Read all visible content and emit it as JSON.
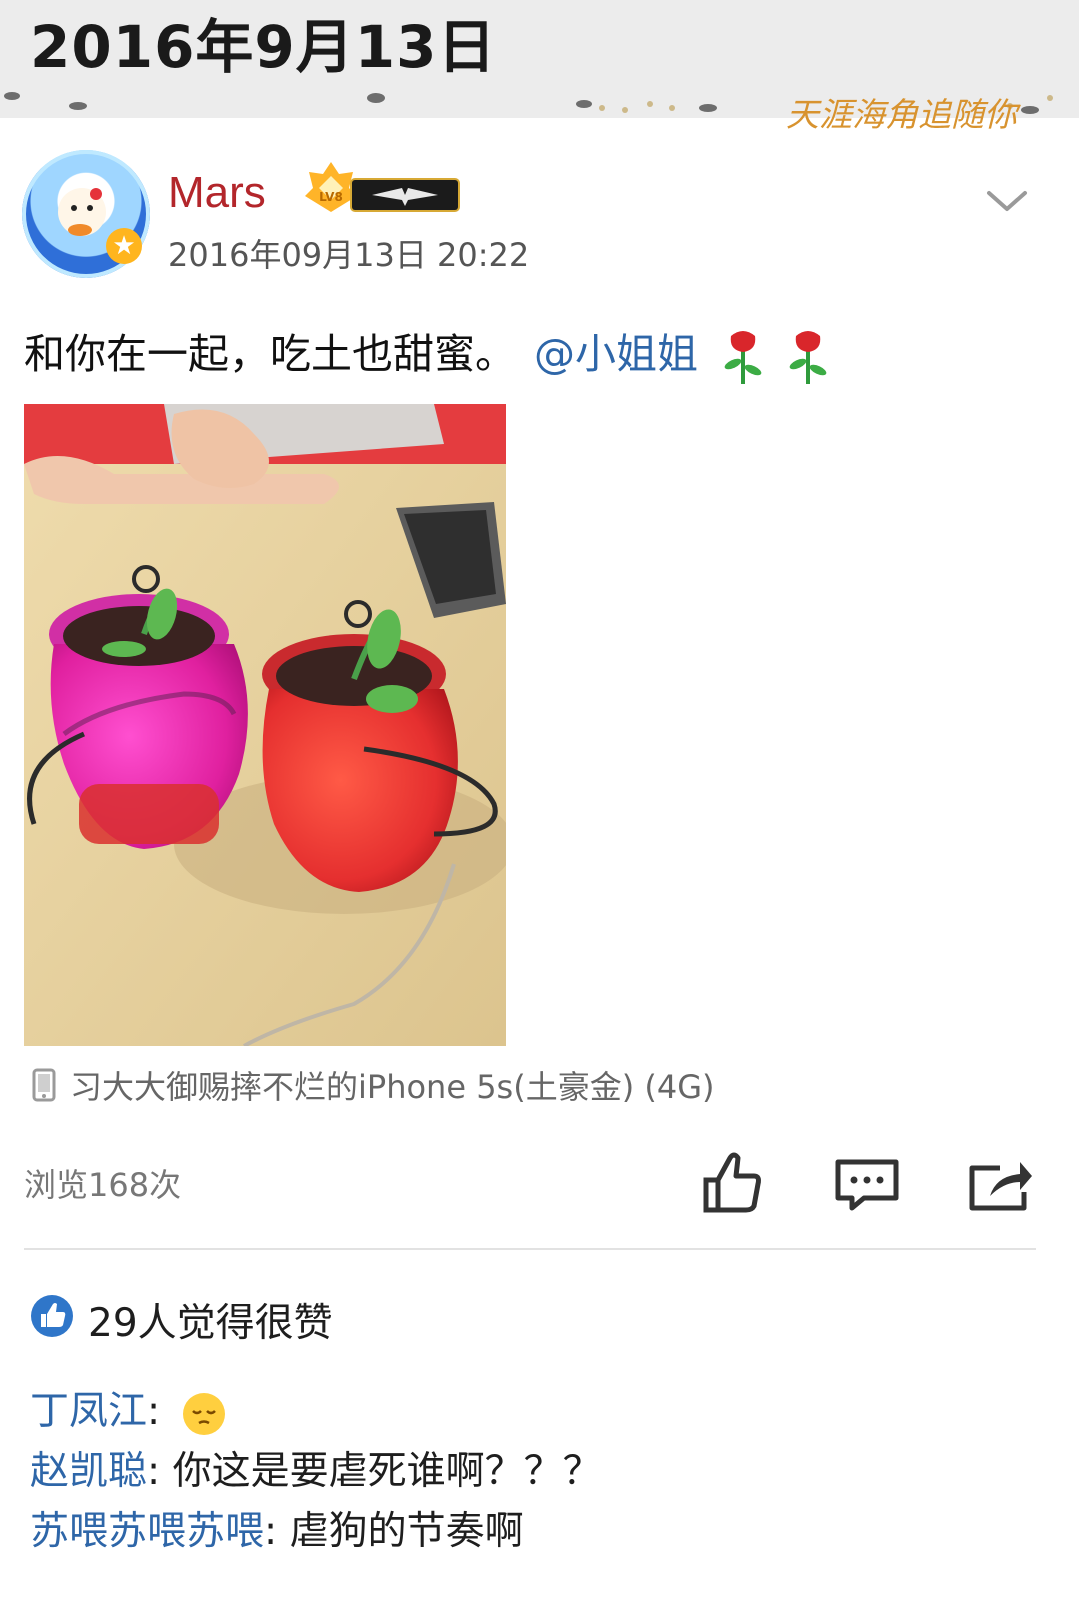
{
  "header": {
    "date": "2016年9月13日",
    "theme_text": "天涯海角追随你"
  },
  "post": {
    "username": "Mars",
    "level_badge": "LV8",
    "timestamp": "2016年09月13日 20:22",
    "text": "和你在一起，吃土也甜蜜。",
    "mention": "@小姐姐",
    "device": "习大大御赐摔不烂的iPhone 5s(土豪金) (4G)",
    "views": "浏览168次"
  },
  "likes": {
    "summary": "29人觉得很赞"
  },
  "comments": [
    {
      "author": "丁凤江",
      "sep": ": ",
      "text": ""
    },
    {
      "author": "赵凯聪",
      "sep": ": ",
      "text": "你这是要虐死谁啊？？？"
    },
    {
      "author": "苏喂苏喂苏喂",
      "sep": ": ",
      "text": "虐狗的节奏啊"
    }
  ],
  "colors": {
    "username": "#b3262b",
    "link": "#2e66a8",
    "accent_blue": "#2f76c9"
  }
}
